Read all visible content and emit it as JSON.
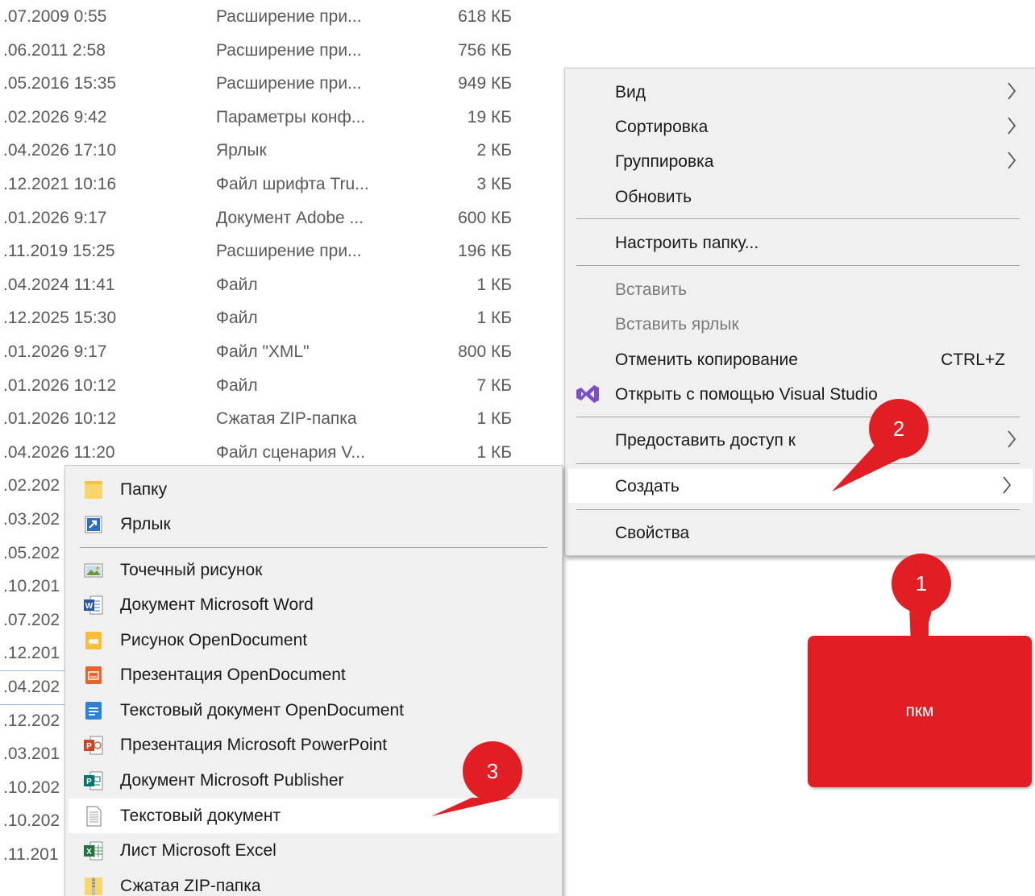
{
  "file_list": {
    "rows": [
      {
        "date": ".07.2009 0:55",
        "type": "Расширение при...",
        "size": "618 КБ"
      },
      {
        "date": ".06.2011 2:58",
        "type": "Расширение при...",
        "size": "756 КБ"
      },
      {
        "date": ".05.2016 15:35",
        "type": "Расширение при...",
        "size": "949 КБ"
      },
      {
        "date": ".02.2026 9:42",
        "type": "Параметры конф...",
        "size": "19 КБ"
      },
      {
        "date": ".04.2026 17:10",
        "type": "Ярлык",
        "size": "2 КБ"
      },
      {
        "date": ".12.2021 10:16",
        "type": "Файл шрифта Tru...",
        "size": "3 КБ"
      },
      {
        "date": ".01.2026 9:17",
        "type": "Документ Adobe ...",
        "size": "600 КБ"
      },
      {
        "date": ".11.2019 15:25",
        "type": "Расширение при...",
        "size": "196 КБ"
      },
      {
        "date": ".04.2024 11:41",
        "type": "Файл",
        "size": "1 КБ"
      },
      {
        "date": ".12.2025 15:30",
        "type": "Файл",
        "size": "1 КБ"
      },
      {
        "date": ".01.2026 9:17",
        "type": "Файл \"XML\"",
        "size": "800 КБ"
      },
      {
        "date": ".01.2026 10:12",
        "type": "Файл",
        "size": "7 КБ"
      },
      {
        "date": ".01.2026 10:12",
        "type": "Сжатая ZIP-папка",
        "size": "1 КБ"
      },
      {
        "date": ".04.2026 11:20",
        "type": "Файл сценария V...",
        "size": "1 КБ"
      },
      {
        "date": ".02.202",
        "type": "",
        "size": ""
      },
      {
        "date": ".03.202",
        "type": "",
        "size": ""
      },
      {
        "date": ".05.202",
        "type": "",
        "size": ""
      },
      {
        "date": ".10.201",
        "type": "",
        "size": ""
      },
      {
        "date": ".07.202",
        "type": "",
        "size": ""
      },
      {
        "date": ".12.201",
        "type": "",
        "size": ""
      },
      {
        "date": ".04.202",
        "type": "",
        "size": ""
      },
      {
        "date": ".12.202",
        "type": "",
        "size": ""
      },
      {
        "date": ".03.201",
        "type": "",
        "size": ""
      },
      {
        "date": ".10.202",
        "type": "",
        "size": ""
      },
      {
        "date": ".10.202",
        "type": "",
        "size": ""
      },
      {
        "date": ".11.201",
        "type": "",
        "size": ""
      }
    ]
  },
  "context_menu": {
    "view": "Вид",
    "sort": "Сортировка",
    "group": "Группировка",
    "refresh": "Обновить",
    "customize": "Настроить папку...",
    "paste": "Вставить",
    "paste_shortcut": "Вставить ярлык",
    "undo_copy": "Отменить копирование",
    "undo_copy_key": "CTRL+Z",
    "open_vs": "Открыть с помощью Visual Studio",
    "give_access": "Предоставить доступ к",
    "create": "Создать",
    "properties": "Свойства"
  },
  "create_submenu": {
    "folder": "Папку",
    "shortcut": "Ярлык",
    "bitmap": "Точечный рисунок",
    "word": "Документ Microsoft Word",
    "od_drawing": "Рисунок OpenDocument",
    "od_presentation": "Презентация OpenDocument",
    "od_text": "Текстовый документ OpenDocument",
    "powerpoint": "Презентация Microsoft PowerPoint",
    "publisher": "Документ Microsoft Publisher",
    "text_doc": "Текстовый документ",
    "excel": "Лист Microsoft Excel",
    "zip": "Сжатая ZIP-папка"
  },
  "annotations": {
    "step1": "1",
    "step2": "2",
    "step3": "3",
    "pkm_label": "пкм",
    "accent_color": "#e01e24"
  }
}
